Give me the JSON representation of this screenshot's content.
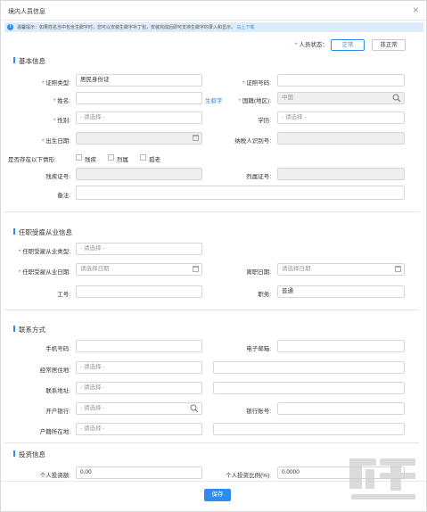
{
  "title": "境内人员信息",
  "notice": {
    "text": "温馨提示：如果姓名当中包含生僻字时，您可以安装生僻字补丁包，安装完成后即可支持生僻字的录入和显示。",
    "link": "马上下载"
  },
  "status": {
    "label": "人员状态：",
    "normal": "正常",
    "abnormal": "非正常"
  },
  "basic": {
    "section": "基本信息",
    "id_type_label": "证照类型:",
    "id_type_value": "居民身份证",
    "id_no_label": "证照号码:",
    "name_label": "姓名:",
    "rare_char": "生僻字",
    "country_label": "国籍(地区):",
    "country_value": "中国",
    "gender_label": "性别:",
    "gender_value": "- 请选择 -",
    "edu_label": "学历:",
    "edu_value": "- 请选择 -",
    "birth_label": "出生日期:",
    "taxid_label": "纳税人识别号:",
    "special_label": "是否存在以下情形:",
    "opt1": "残疾",
    "opt2": "烈属",
    "opt3": "孤老",
    "disab_label": "残疾证号:",
    "martyr_label": "烈属证号:",
    "remark_label": "备注:"
  },
  "employment": {
    "section": "任职受雇从业信息",
    "type_label": "任职受雇从业类型:",
    "type_value": "- 请选择 -",
    "date_label": "任职受雇从业日期:",
    "date_ph": "请选择日期",
    "leave_label": "离职日期:",
    "leave_ph": "请选择日期",
    "workno_label": "工号:",
    "post_label": "职务:",
    "post_value": "普通"
  },
  "contact": {
    "section": "联系方式",
    "phone_label": "手机号码:",
    "email_label": "电子邮箱:",
    "residence_label": "经常居住地:",
    "residence_value": "- 请选择 -",
    "address_label": "联系地址:",
    "address_value": "- 请选择 -",
    "bank_label": "开户银行:",
    "bank_value": "- 请选择 -",
    "account_label": "银行账号:",
    "household_label": "户籍所在地:",
    "household_value": "- 请选择 -"
  },
  "invest": {
    "section": "投资信息",
    "amount_label": "个人投资额:",
    "amount_value": "0.00",
    "ratio_label": "个人投资比例(%):",
    "ratio_value": "0.0000"
  },
  "save": "保存",
  "colors": {
    "accent": "#2d8cf0",
    "required": "#e4393c",
    "notice_bg": "#dcecfb"
  }
}
